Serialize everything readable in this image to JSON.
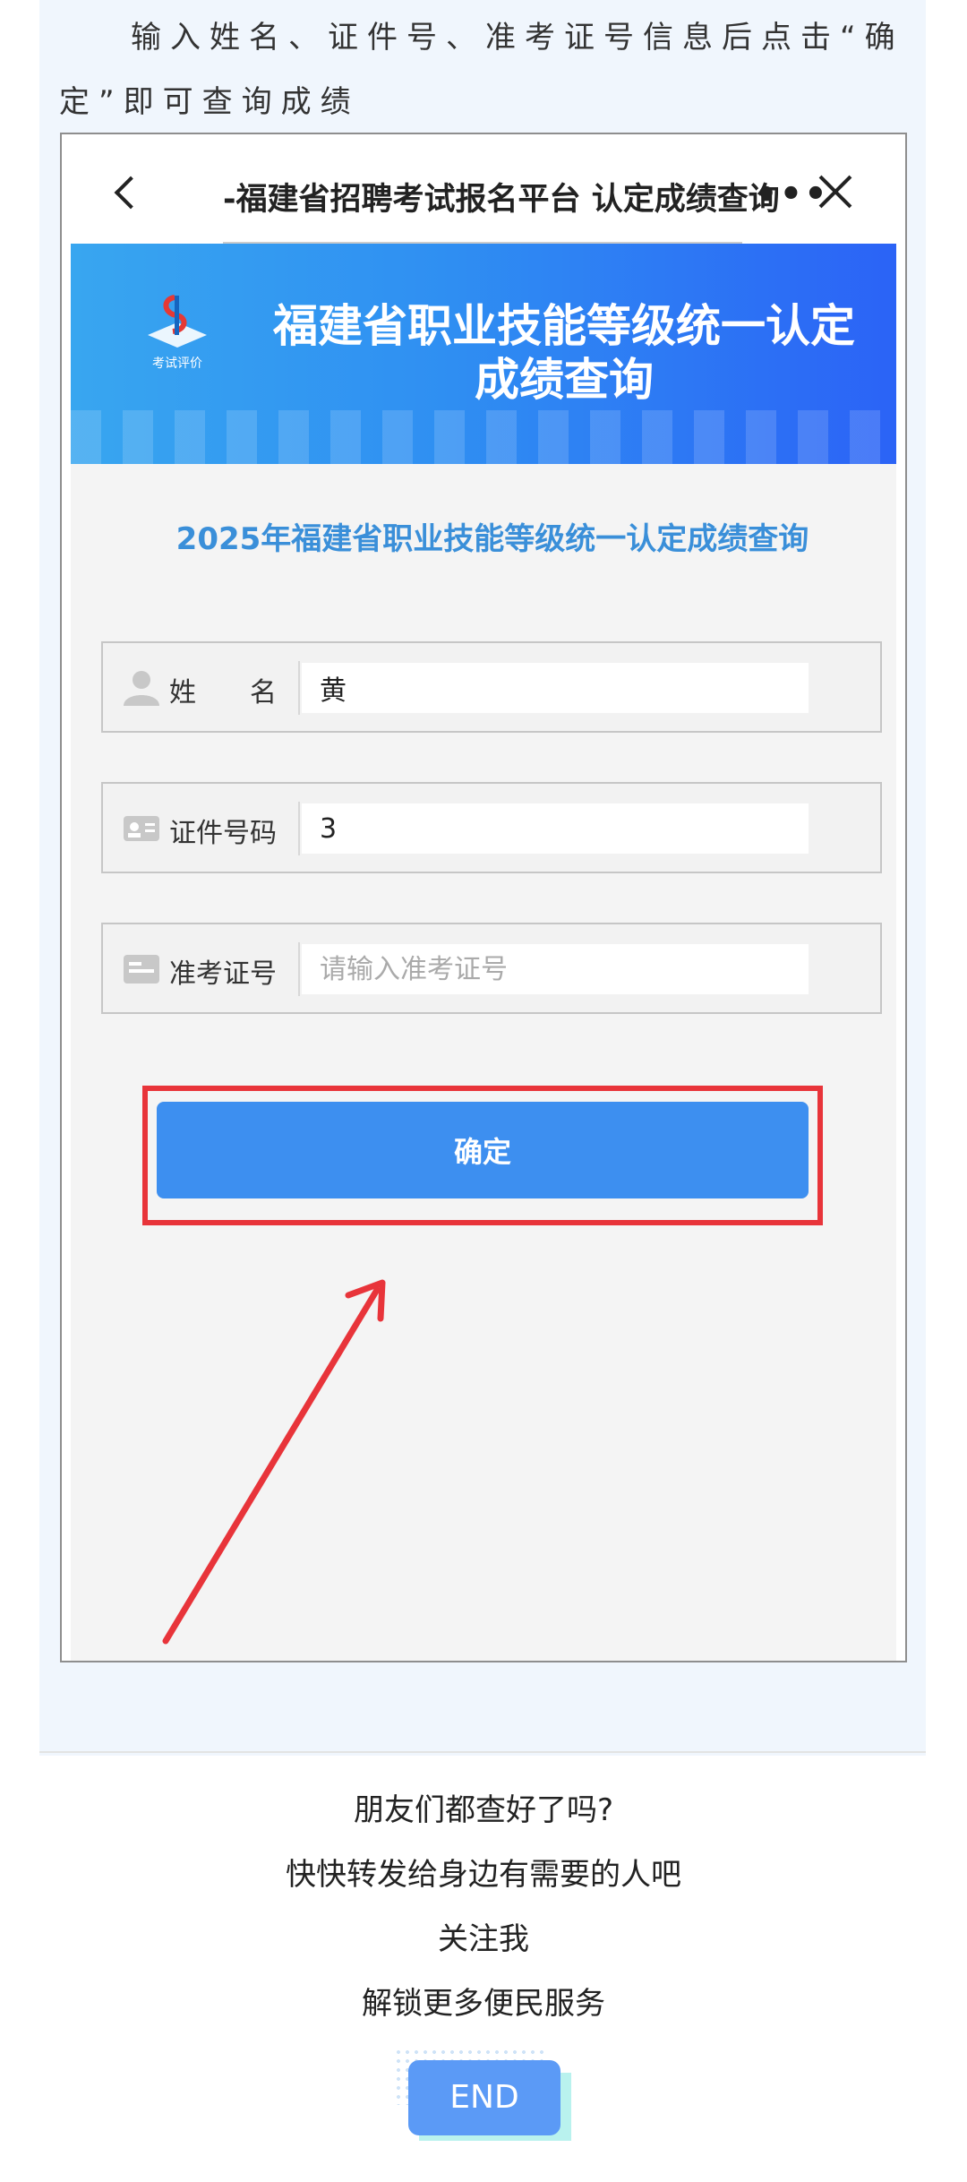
{
  "article": {
    "intro_text": "输入姓名、证件号、准考证号信息后点击“确定”即可查询成绩",
    "outro_lines": [
      "朋友们都查好了吗?",
      "快快转发给身边有需要的人吧",
      "关注我",
      "解锁更多便民服务"
    ],
    "end_label": "END"
  },
  "screenshot": {
    "navbar": {
      "title": "-福建省招聘考试报名平台  认定成绩查询",
      "more": "•••"
    },
    "banner": {
      "logo_text": "考试评价",
      "title_line1": "福建省职业技能等级统一认定",
      "title_line2": "成绩查询"
    },
    "heading": "2025年福建省职业技能等级统一认定成绩查询",
    "fields": [
      {
        "label": "姓　　名",
        "value": "黄",
        "placeholder": ""
      },
      {
        "label": "证件号码",
        "value": "3",
        "placeholder": ""
      },
      {
        "label": "准考证号",
        "value": "",
        "placeholder": "请输入准考证号"
      }
    ],
    "confirm_label": "确定"
  },
  "colors": {
    "accent": "#3d8ff0",
    "heading": "#3a8fd9",
    "highlight": "#e8343a",
    "end_badge": "#5b9af6"
  }
}
